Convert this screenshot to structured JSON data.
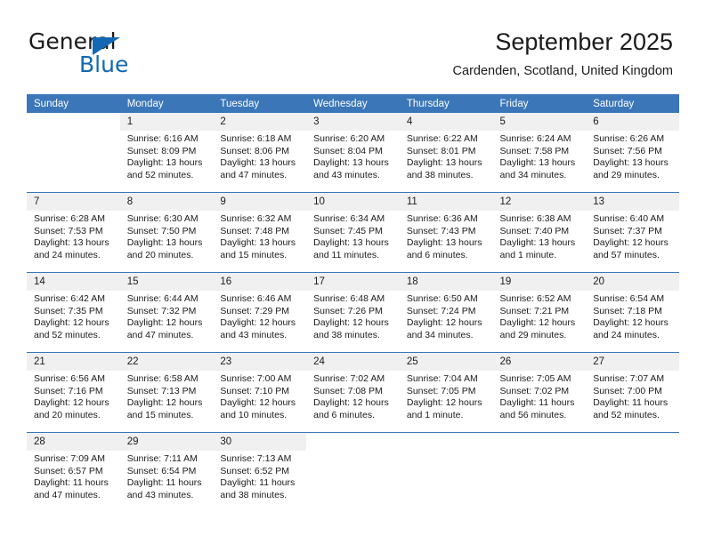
{
  "brand": {
    "name_part1": "General",
    "name_part2": "Blue",
    "accent_color": "#1268b3",
    "logo_icon": "triangle-logo-icon"
  },
  "header": {
    "title": "September 2025",
    "subtitle": "Cardenden, Scotland, United Kingdom"
  },
  "calendar": {
    "header_bg": "#3a76b8",
    "daynum_bg": "#f0f0f0",
    "weekday_headers": [
      "Sunday",
      "Monday",
      "Tuesday",
      "Wednesday",
      "Thursday",
      "Friday",
      "Saturday"
    ],
    "weeks": [
      [
        {
          "day": "",
          "lines": []
        },
        {
          "day": "1",
          "lines": [
            "Sunrise: 6:16 AM",
            "Sunset: 8:09 PM",
            "Daylight: 13 hours and 52 minutes."
          ]
        },
        {
          "day": "2",
          "lines": [
            "Sunrise: 6:18 AM",
            "Sunset: 8:06 PM",
            "Daylight: 13 hours and 47 minutes."
          ]
        },
        {
          "day": "3",
          "lines": [
            "Sunrise: 6:20 AM",
            "Sunset: 8:04 PM",
            "Daylight: 13 hours and 43 minutes."
          ]
        },
        {
          "day": "4",
          "lines": [
            "Sunrise: 6:22 AM",
            "Sunset: 8:01 PM",
            "Daylight: 13 hours and 38 minutes."
          ]
        },
        {
          "day": "5",
          "lines": [
            "Sunrise: 6:24 AM",
            "Sunset: 7:58 PM",
            "Daylight: 13 hours and 34 minutes."
          ]
        },
        {
          "day": "6",
          "lines": [
            "Sunrise: 6:26 AM",
            "Sunset: 7:56 PM",
            "Daylight: 13 hours and 29 minutes."
          ]
        }
      ],
      [
        {
          "day": "7",
          "lines": [
            "Sunrise: 6:28 AM",
            "Sunset: 7:53 PM",
            "Daylight: 13 hours and 24 minutes."
          ]
        },
        {
          "day": "8",
          "lines": [
            "Sunrise: 6:30 AM",
            "Sunset: 7:50 PM",
            "Daylight: 13 hours and 20 minutes."
          ]
        },
        {
          "day": "9",
          "lines": [
            "Sunrise: 6:32 AM",
            "Sunset: 7:48 PM",
            "Daylight: 13 hours and 15 minutes."
          ]
        },
        {
          "day": "10",
          "lines": [
            "Sunrise: 6:34 AM",
            "Sunset: 7:45 PM",
            "Daylight: 13 hours and 11 minutes."
          ]
        },
        {
          "day": "11",
          "lines": [
            "Sunrise: 6:36 AM",
            "Sunset: 7:43 PM",
            "Daylight: 13 hours and 6 minutes."
          ]
        },
        {
          "day": "12",
          "lines": [
            "Sunrise: 6:38 AM",
            "Sunset: 7:40 PM",
            "Daylight: 13 hours and 1 minute."
          ]
        },
        {
          "day": "13",
          "lines": [
            "Sunrise: 6:40 AM",
            "Sunset: 7:37 PM",
            "Daylight: 12 hours and 57 minutes."
          ]
        }
      ],
      [
        {
          "day": "14",
          "lines": [
            "Sunrise: 6:42 AM",
            "Sunset: 7:35 PM",
            "Daylight: 12 hours and 52 minutes."
          ]
        },
        {
          "day": "15",
          "lines": [
            "Sunrise: 6:44 AM",
            "Sunset: 7:32 PM",
            "Daylight: 12 hours and 47 minutes."
          ]
        },
        {
          "day": "16",
          "lines": [
            "Sunrise: 6:46 AM",
            "Sunset: 7:29 PM",
            "Daylight: 12 hours and 43 minutes."
          ]
        },
        {
          "day": "17",
          "lines": [
            "Sunrise: 6:48 AM",
            "Sunset: 7:26 PM",
            "Daylight: 12 hours and 38 minutes."
          ]
        },
        {
          "day": "18",
          "lines": [
            "Sunrise: 6:50 AM",
            "Sunset: 7:24 PM",
            "Daylight: 12 hours and 34 minutes."
          ]
        },
        {
          "day": "19",
          "lines": [
            "Sunrise: 6:52 AM",
            "Sunset: 7:21 PM",
            "Daylight: 12 hours and 29 minutes."
          ]
        },
        {
          "day": "20",
          "lines": [
            "Sunrise: 6:54 AM",
            "Sunset: 7:18 PM",
            "Daylight: 12 hours and 24 minutes."
          ]
        }
      ],
      [
        {
          "day": "21",
          "lines": [
            "Sunrise: 6:56 AM",
            "Sunset: 7:16 PM",
            "Daylight: 12 hours and 20 minutes."
          ]
        },
        {
          "day": "22",
          "lines": [
            "Sunrise: 6:58 AM",
            "Sunset: 7:13 PM",
            "Daylight: 12 hours and 15 minutes."
          ]
        },
        {
          "day": "23",
          "lines": [
            "Sunrise: 7:00 AM",
            "Sunset: 7:10 PM",
            "Daylight: 12 hours and 10 minutes."
          ]
        },
        {
          "day": "24",
          "lines": [
            "Sunrise: 7:02 AM",
            "Sunset: 7:08 PM",
            "Daylight: 12 hours and 6 minutes."
          ]
        },
        {
          "day": "25",
          "lines": [
            "Sunrise: 7:04 AM",
            "Sunset: 7:05 PM",
            "Daylight: 12 hours and 1 minute."
          ]
        },
        {
          "day": "26",
          "lines": [
            "Sunrise: 7:05 AM",
            "Sunset: 7:02 PM",
            "Daylight: 11 hours and 56 minutes."
          ]
        },
        {
          "day": "27",
          "lines": [
            "Sunrise: 7:07 AM",
            "Sunset: 7:00 PM",
            "Daylight: 11 hours and 52 minutes."
          ]
        }
      ],
      [
        {
          "day": "28",
          "lines": [
            "Sunrise: 7:09 AM",
            "Sunset: 6:57 PM",
            "Daylight: 11 hours and 47 minutes."
          ]
        },
        {
          "day": "29",
          "lines": [
            "Sunrise: 7:11 AM",
            "Sunset: 6:54 PM",
            "Daylight: 11 hours and 43 minutes."
          ]
        },
        {
          "day": "30",
          "lines": [
            "Sunrise: 7:13 AM",
            "Sunset: 6:52 PM",
            "Daylight: 11 hours and 38 minutes."
          ]
        },
        {
          "day": "",
          "lines": []
        },
        {
          "day": "",
          "lines": []
        },
        {
          "day": "",
          "lines": []
        },
        {
          "day": "",
          "lines": []
        }
      ]
    ]
  }
}
